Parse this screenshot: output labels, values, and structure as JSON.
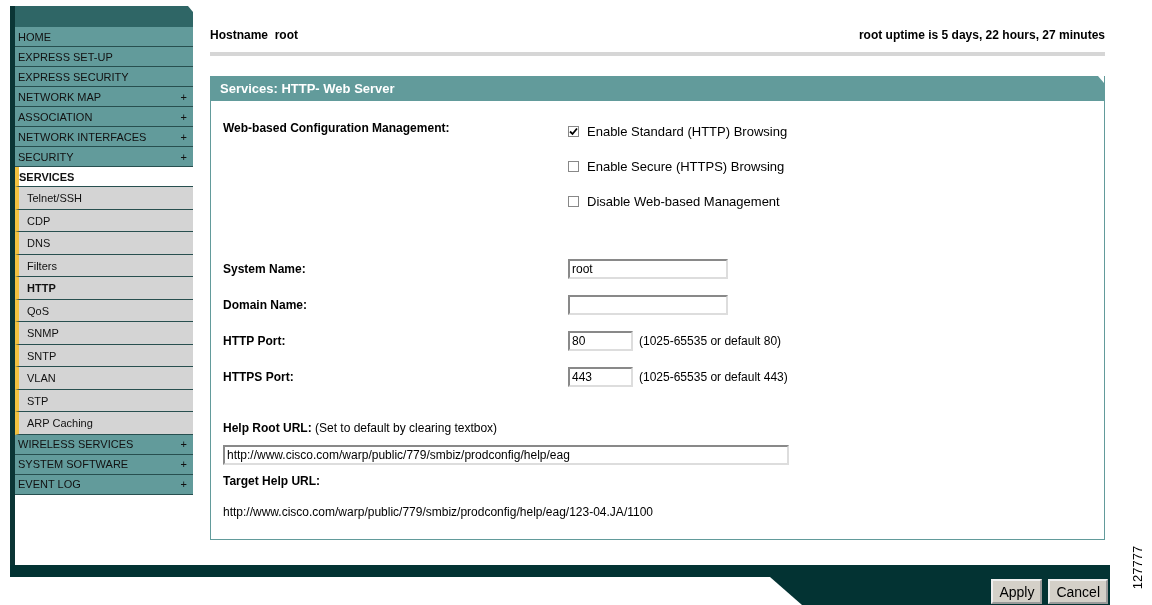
{
  "header": {
    "hostname": "Hostname  root",
    "uptime": "root uptime is 5 days, 22 hours, 27 minutes"
  },
  "sidebar": {
    "items": [
      {
        "label": "HOME",
        "selected": false
      },
      {
        "label": "EXPRESS SET-UP",
        "selected": false
      },
      {
        "label": "EXPRESS SECURITY",
        "selected": false
      },
      {
        "label": "NETWORK MAP",
        "expander": "+",
        "selected": false
      },
      {
        "label": "ASSOCIATION",
        "expander": "+",
        "selected": false
      },
      {
        "label": "NETWORK INTERFACES",
        "expander": "+",
        "selected": false
      },
      {
        "label": "SECURITY",
        "expander": "+",
        "selected": false
      },
      {
        "label": "SERVICES",
        "selected": true,
        "expanded": true,
        "children": [
          {
            "label": "Telnet/SSH",
            "selected": false
          },
          {
            "label": "CDP",
            "selected": false
          },
          {
            "label": "DNS",
            "selected": false
          },
          {
            "label": "Filters",
            "selected": false
          },
          {
            "label": "HTTP",
            "selected": true
          },
          {
            "label": "QoS",
            "selected": false
          },
          {
            "label": "SNMP",
            "selected": false
          },
          {
            "label": "SNTP",
            "selected": false
          },
          {
            "label": "VLAN",
            "selected": false
          },
          {
            "label": "STP",
            "selected": false
          },
          {
            "label": "ARP Caching",
            "selected": false
          }
        ]
      },
      {
        "label": "WIRELESS SERVICES",
        "expander": "+",
        "selected": false
      },
      {
        "label": "SYSTEM SOFTWARE",
        "expander": "+",
        "selected": false
      },
      {
        "label": "EVENT LOG",
        "expander": "+",
        "selected": false
      }
    ]
  },
  "panel": {
    "title": "Services: HTTP- Web Server",
    "management": {
      "label": "Web-based Configuration Management:",
      "options": [
        {
          "label": "Enable Standard (HTTP) Browsing",
          "checked": true
        },
        {
          "label": "Enable Secure (HTTPS) Browsing",
          "checked": false
        },
        {
          "label": "Disable Web-based Management",
          "checked": false
        }
      ]
    },
    "fields": [
      {
        "kind": "text",
        "label": "System Name:",
        "value": "root"
      },
      {
        "kind": "text",
        "label": "Domain Name:"
      },
      {
        "kind": "port",
        "label": "HTTP Port:",
        "value": "80",
        "hint": "(1025-65535 or default 80)"
      },
      {
        "kind": "port",
        "label": "HTTPS Port:",
        "value": "443",
        "hint": "(1025-65535 or default 443)"
      }
    ],
    "help_root": {
      "label": "**Help Root URL:** (Set to default by clearing textbox)",
      "value": "http://www.cisco.com/warp/public/779/smbiz/prodconfig/help/eag"
    },
    "target_help": {
      "label": "Target Help URL:",
      "value": "http://www.cisco.com/warp/public/779/smbiz/prodconfig/help/eag/123-04.JA/1100"
    }
  },
  "buttons": [
    "Apply",
    "Cancel"
  ],
  "figure_id": "127777"
}
